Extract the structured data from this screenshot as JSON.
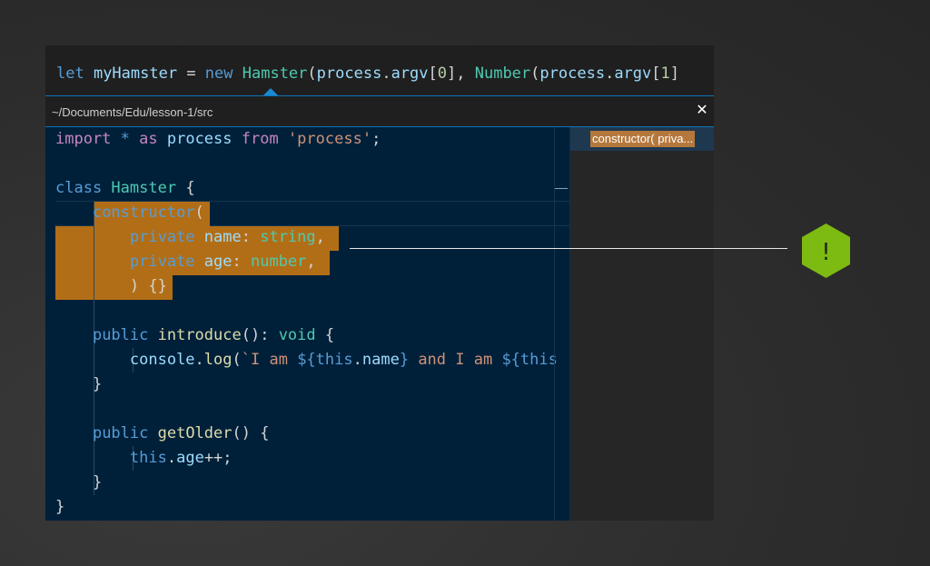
{
  "top_code_line": [
    {
      "t": "let ",
      "c": "kb"
    },
    {
      "t": "myHamster",
      "c": "va"
    },
    {
      "t": " = ",
      "c": "pl"
    },
    {
      "t": "new ",
      "c": "kb"
    },
    {
      "t": "Hamster",
      "c": "ty"
    },
    {
      "t": "(",
      "c": "pl"
    },
    {
      "t": "process",
      "c": "va"
    },
    {
      "t": ".",
      "c": "pl"
    },
    {
      "t": "argv",
      "c": "va"
    },
    {
      "t": "[",
      "c": "pl"
    },
    {
      "t": "0",
      "c": "nm"
    },
    {
      "t": "], ",
      "c": "pl"
    },
    {
      "t": "Number",
      "c": "ty"
    },
    {
      "t": "(",
      "c": "pl"
    },
    {
      "t": "process",
      "c": "va"
    },
    {
      "t": ".",
      "c": "pl"
    },
    {
      "t": "argv",
      "c": "va"
    },
    {
      "t": "[",
      "c": "pl"
    },
    {
      "t": "1",
      "c": "nm"
    },
    {
      "t": "]",
      "c": "pl"
    }
  ],
  "path": "~/Documents/Edu/lesson-1/src",
  "close_label": "✕",
  "code_lines": [
    [
      {
        "t": "import ",
        "c": "kw"
      },
      {
        "t": "* ",
        "c": "kb"
      },
      {
        "t": "as ",
        "c": "kw"
      },
      {
        "t": "process ",
        "c": "va"
      },
      {
        "t": "from ",
        "c": "kw"
      },
      {
        "t": "'process'",
        "c": "st"
      },
      {
        "t": ";",
        "c": "pl"
      }
    ],
    [],
    [
      {
        "t": "class ",
        "c": "kb"
      },
      {
        "t": "Hamster ",
        "c": "ty"
      },
      {
        "t": "{",
        "c": "pl"
      }
    ],
    [
      {
        "t": "    ",
        "c": "pl"
      },
      {
        "t": "constructor",
        "c": "kb"
      },
      {
        "t": "(",
        "c": "pl"
      }
    ],
    [
      {
        "t": "        ",
        "c": "pl"
      },
      {
        "t": "private ",
        "c": "kb"
      },
      {
        "t": "name",
        "c": "va"
      },
      {
        "t": ": ",
        "c": "pl"
      },
      {
        "t": "string",
        "c": "ty"
      },
      {
        "t": ",",
        "c": "pl"
      }
    ],
    [
      {
        "t": "        ",
        "c": "pl"
      },
      {
        "t": "private ",
        "c": "kb"
      },
      {
        "t": "age",
        "c": "va"
      },
      {
        "t": ": ",
        "c": "pl"
      },
      {
        "t": "number",
        "c": "ty"
      },
      {
        "t": ",",
        "c": "pl"
      }
    ],
    [
      {
        "t": "        ",
        "c": "pl"
      },
      {
        "t": ") {}",
        "c": "pl"
      }
    ],
    [],
    [
      {
        "t": "    ",
        "c": "pl"
      },
      {
        "t": "public ",
        "c": "kb"
      },
      {
        "t": "introduce",
        "c": "fn"
      },
      {
        "t": "(): ",
        "c": "pl"
      },
      {
        "t": "void ",
        "c": "ty"
      },
      {
        "t": "{",
        "c": "pl"
      }
    ],
    [
      {
        "t": "        ",
        "c": "pl"
      },
      {
        "t": "console",
        "c": "va"
      },
      {
        "t": ".",
        "c": "pl"
      },
      {
        "t": "log",
        "c": "fn"
      },
      {
        "t": "(",
        "c": "pl"
      },
      {
        "t": "`I am ",
        "c": "st"
      },
      {
        "t": "${",
        "c": "kb"
      },
      {
        "t": "this",
        "c": "kb"
      },
      {
        "t": ".",
        "c": "pl"
      },
      {
        "t": "name",
        "c": "va"
      },
      {
        "t": "}",
        "c": "kb"
      },
      {
        "t": " and I am ",
        "c": "st"
      },
      {
        "t": "${",
        "c": "kb"
      },
      {
        "t": "this",
        "c": "kb"
      }
    ],
    [
      {
        "t": "    ",
        "c": "pl"
      },
      {
        "t": "}",
        "c": "pl"
      }
    ],
    [],
    [
      {
        "t": "    ",
        "c": "pl"
      },
      {
        "t": "public ",
        "c": "kb"
      },
      {
        "t": "getOlder",
        "c": "fn"
      },
      {
        "t": "() {",
        "c": "pl"
      }
    ],
    [
      {
        "t": "        ",
        "c": "pl"
      },
      {
        "t": "this",
        "c": "kb"
      },
      {
        "t": ".",
        "c": "pl"
      },
      {
        "t": "age",
        "c": "va"
      },
      {
        "t": "++;",
        "c": "pl"
      }
    ],
    [
      {
        "t": "    ",
        "c": "pl"
      },
      {
        "t": "}",
        "c": "pl"
      }
    ],
    [
      {
        "t": "}",
        "c": "pl"
      }
    ]
  ],
  "outline_item": "constructor( priva...",
  "badge_symbol": "!",
  "colors": {
    "highlight": "#b26e16",
    "badge": "#7dbb12",
    "editor_bg": "#00203a",
    "accent_border": "#0f74b8"
  }
}
